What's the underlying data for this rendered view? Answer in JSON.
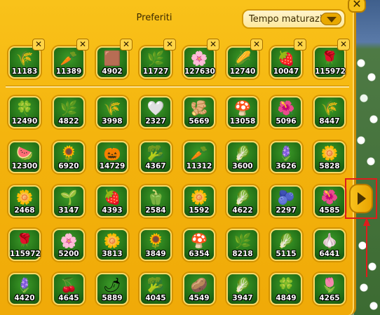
{
  "panel": {
    "title": "Preferiti",
    "close_label": "✕",
    "sort_dropdown": {
      "selected": "Tempo maturazione"
    }
  },
  "favorites": [
    {
      "count": "11183",
      "icon": "wheat-icon",
      "glyph": "🌾"
    },
    {
      "count": "11389",
      "icon": "carrot-icon",
      "glyph": "🥕"
    },
    {
      "count": "4902",
      "icon": "hay-bale-icon",
      "glyph": "🟫"
    },
    {
      "count": "11727",
      "icon": "grain-icon",
      "glyph": "🌿"
    },
    {
      "count": "127630",
      "icon": "flower-icon",
      "glyph": "🌸"
    },
    {
      "count": "12740",
      "icon": "corn-icon",
      "glyph": "🌽"
    },
    {
      "count": "10047",
      "icon": "strawberry-icon",
      "glyph": "🍓"
    },
    {
      "count": "115972",
      "icon": "rose-icon",
      "glyph": "🌹"
    }
  ],
  "remove_label": "✕",
  "grid": [
    {
      "count": "12490",
      "icon": "clover-icon",
      "glyph": "🍀"
    },
    {
      "count": "4822",
      "icon": "herb-icon",
      "glyph": "🌿"
    },
    {
      "count": "3998",
      "icon": "grass-icon",
      "glyph": "🌾"
    },
    {
      "count": "2327",
      "icon": "lily-of-valley-icon",
      "glyph": "🤍"
    },
    {
      "count": "5669",
      "icon": "ginger-icon",
      "glyph": "🫚"
    },
    {
      "count": "13058",
      "icon": "mushroom-icon",
      "glyph": "🍄"
    },
    {
      "count": "5096",
      "icon": "hydrangea-icon",
      "glyph": "🌺"
    },
    {
      "count": "8447",
      "icon": "wheat-stalk-icon",
      "glyph": "🌾"
    },
    {
      "count": "12300",
      "icon": "watermelon-icon",
      "glyph": "🍉"
    },
    {
      "count": "6920",
      "icon": "sunflower-icon",
      "glyph": "🌻"
    },
    {
      "count": "14729",
      "icon": "pumpkin-icon",
      "glyph": "🎃"
    },
    {
      "count": "4367",
      "icon": "cauliflower-icon",
      "glyph": "🥦"
    },
    {
      "count": "11312",
      "icon": "radish-icon",
      "glyph": "🥕"
    },
    {
      "count": "3600",
      "icon": "leek-icon",
      "glyph": "🥬"
    },
    {
      "count": "3626",
      "icon": "violet-icon",
      "glyph": "🪻"
    },
    {
      "count": "5828",
      "icon": "daisy-icon",
      "glyph": "🌼"
    },
    {
      "count": "2468",
      "icon": "white-daisy-icon",
      "glyph": "🌼"
    },
    {
      "count": "3147",
      "icon": "lily-icon",
      "glyph": "🌱"
    },
    {
      "count": "4393",
      "icon": "raspberry-icon",
      "glyph": "🍓"
    },
    {
      "count": "2584",
      "icon": "yellow-pepper-icon",
      "glyph": "🫑"
    },
    {
      "count": "1592",
      "icon": "mimosa-icon",
      "glyph": "🌼"
    },
    {
      "count": "4622",
      "icon": "cabbage-icon",
      "glyph": "🥬"
    },
    {
      "count": "2297",
      "icon": "blueberry-icon",
      "glyph": "🫐"
    },
    {
      "count": "4585",
      "icon": "poppy-icon",
      "glyph": "🌺"
    },
    {
      "count": "115972",
      "icon": "red-rose-icon",
      "glyph": "🌹"
    },
    {
      "count": "5200",
      "icon": "orchid-icon",
      "glyph": "🌸"
    },
    {
      "count": "3813",
      "icon": "daffodil-icon",
      "glyph": "🌼"
    },
    {
      "count": "3849",
      "icon": "chamomile-icon",
      "glyph": "🌻"
    },
    {
      "count": "6354",
      "icon": "chanterelle-icon",
      "glyph": "🍄"
    },
    {
      "count": "8218",
      "icon": "fern-icon",
      "glyph": "🌿"
    },
    {
      "count": "5115",
      "icon": "fennel-icon",
      "glyph": "🥬"
    },
    {
      "count": "6441",
      "icon": "garlic-icon",
      "glyph": "🧄"
    },
    {
      "count": "4420",
      "icon": "lavender-icon",
      "glyph": "🪻"
    },
    {
      "count": "4645",
      "icon": "red-berries-icon",
      "glyph": "🍒"
    },
    {
      "count": "5889",
      "icon": "chili-icon",
      "glyph": "🌶"
    },
    {
      "count": "4045",
      "icon": "broccoli-icon",
      "glyph": "🥦"
    },
    {
      "count": "4549",
      "icon": "potato-icon",
      "glyph": "🥔"
    },
    {
      "count": "3947",
      "icon": "red-cabbage-icon",
      "glyph": "🥬"
    },
    {
      "count": "4849",
      "icon": "four-leaf-clover-icon",
      "glyph": "🍀"
    },
    {
      "count": "4265",
      "icon": "tulip-icon",
      "glyph": "🌷"
    }
  ],
  "colors": {
    "panel": "#f3b20c",
    "tile": "#1f6a14",
    "highlight": "#e01c1c"
  }
}
